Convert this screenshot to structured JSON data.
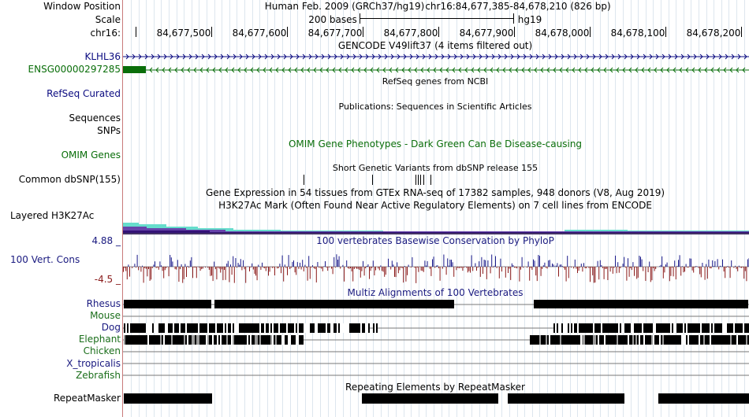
{
  "labels": {
    "window_position": "Window Position",
    "scale": "Scale",
    "chrom": "chr16:",
    "klhl36": "KLHL36",
    "ensg": "ENSG00000297285",
    "refseq_curated": "RefSeq Curated",
    "sequences": "Sequences",
    "snps": "SNPs",
    "omim_genes": "OMIM Genes",
    "common_dbsnp": "Common dbSNP(155)",
    "layered_h3k27ac": "Layered H3K27Ac",
    "cons_max": "4.88 _",
    "cons_label": "100 Vert. Cons",
    "cons_min": "-4.5 _",
    "species": [
      "Rhesus",
      "Mouse",
      "Dog",
      "Elephant",
      "Chicken",
      "X_tropicalis",
      "Zebrafish"
    ],
    "repeatmasker": "RepeatMasker"
  },
  "header": {
    "assembly": "Human Feb. 2009 (GRCh37/hg19)",
    "position": "chr16:84,677,385-84,678,210 (826 bp)",
    "scale_text": "200 bases",
    "scale_db": "hg19"
  },
  "ruler": [
    "84,677,500",
    "84,677,600",
    "84,677,700",
    "84,677,800",
    "84,677,900",
    "84,678,000",
    "84,678,100",
    "84,678,200"
  ],
  "tracks": {
    "gencode": "GENCODE V49lift37 (4 items filtered out)",
    "refseq": "RefSeq genes from NCBI",
    "publications": "Publications: Sequences in Scientific Articles",
    "omim": "OMIM Gene Phenotypes - Dark Green Can Be Disease-causing",
    "dbsnp": "Short Genetic Variants from dbSNP release 155",
    "gtex": "Gene Expression in 54 tissues from GTEx RNA-seq of 17382 samples, 948 donors (V8, Aug 2019)",
    "h3k27ac": "H3K27Ac Mark (Often Found Near Active Regulatory Elements) on 7 cell lines from ENCODE",
    "conservation": "100 vertebrates Basewise Conservation by PhyloP",
    "multiz": "Multiz Alignments of 100 Vertebrates",
    "repeats": "Repeating Elements by RepeatMasker"
  },
  "colors": {
    "klhl36": "#0a0a80",
    "ensg": "#0a6e0a",
    "refseq_curated": "#0a0a80",
    "omim": "#0a6e0a",
    "conservation_pos": "#1a1a8a",
    "conservation_neg": "#8a1a1a",
    "h3k27ac_top": "#66ddcc",
    "h3k27ac_mid": "#6644aa",
    "h3k27ac_low": "#331177",
    "species_label": "#1a1a80"
  }
}
